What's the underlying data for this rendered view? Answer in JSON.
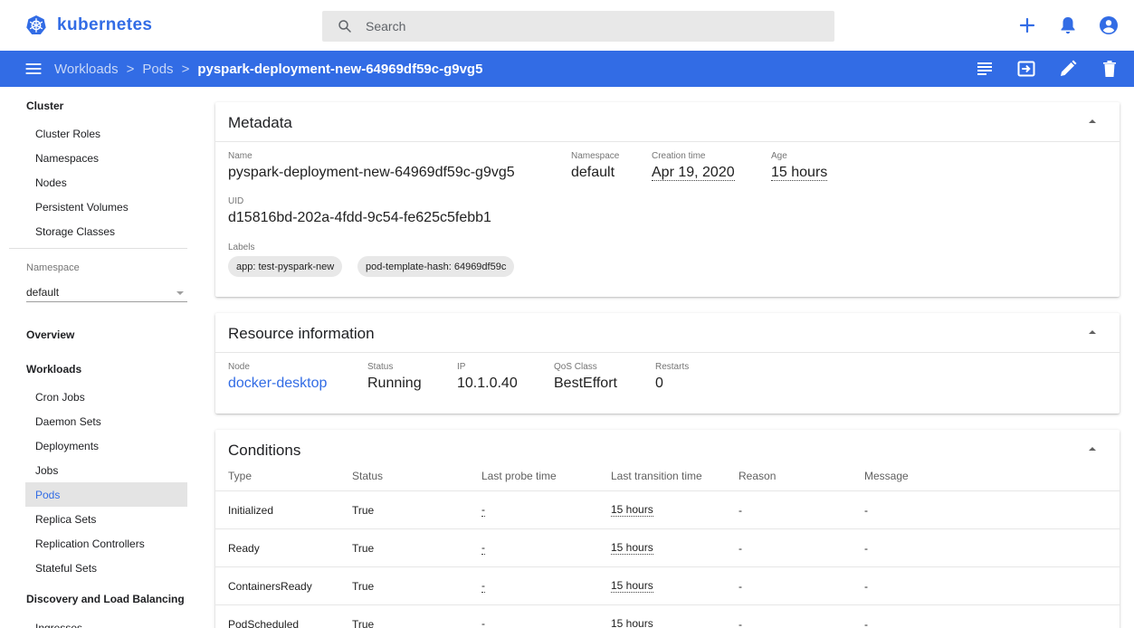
{
  "header": {
    "brand": "kubernetes",
    "search_placeholder": "Search"
  },
  "toolbar": {
    "breadcrumb": [
      "Workloads",
      "Pods"
    ],
    "separator": ">",
    "current": "pyspark-deployment-new-64969df59c-g9vg5"
  },
  "sidebar": {
    "cluster_header": "Cluster",
    "cluster_items": [
      "Cluster Roles",
      "Namespaces",
      "Nodes",
      "Persistent Volumes",
      "Storage Classes"
    ],
    "namespace_label": "Namespace",
    "namespace_value": "default",
    "overview": "Overview",
    "workloads_header": "Workloads",
    "workload_items": [
      "Cron Jobs",
      "Daemon Sets",
      "Deployments",
      "Jobs",
      "Pods",
      "Replica Sets",
      "Replication Controllers",
      "Stateful Sets"
    ],
    "active_item": "Pods",
    "discovery_header": "Discovery and Load Balancing",
    "discovery_items": [
      "Ingresses"
    ]
  },
  "metadata": {
    "title": "Metadata",
    "name_label": "Name",
    "name": "pyspark-deployment-new-64969df59c-g9vg5",
    "namespace_label": "Namespace",
    "namespace": "default",
    "creation_label": "Creation time",
    "creation": "Apr 19, 2020",
    "age_label": "Age",
    "age": "15 hours",
    "uid_label": "UID",
    "uid": "d15816bd-202a-4fdd-9c54-fe625c5febb1",
    "labels_label": "Labels",
    "labels": [
      "app: test-pyspark-new",
      "pod-template-hash: 64969df59c"
    ]
  },
  "resource": {
    "title": "Resource information",
    "node_label": "Node",
    "node": "docker-desktop",
    "status_label": "Status",
    "status": "Running",
    "ip_label": "IP",
    "ip": "10.1.0.40",
    "qos_label": "QoS Class",
    "qos": "BestEffort",
    "restarts_label": "Restarts",
    "restarts": "0"
  },
  "conditions": {
    "title": "Conditions",
    "columns": [
      "Type",
      "Status",
      "Last probe time",
      "Last transition time",
      "Reason",
      "Message"
    ],
    "rows": [
      [
        "Initialized",
        "True",
        "-",
        "15 hours",
        "-",
        "-"
      ],
      [
        "Ready",
        "True",
        "-",
        "15 hours",
        "-",
        "-"
      ],
      [
        "ContainersReady",
        "True",
        "-",
        "15 hours",
        "-",
        "-"
      ],
      [
        "PodScheduled",
        "True",
        "-",
        "15 hours",
        "-",
        "-"
      ]
    ]
  },
  "colors": {
    "primary": "#326ce5",
    "sidebar_active_bg": "#e4e4e4",
    "chip_bg": "#e8e8e8"
  },
  "icons": {
    "brand": "kubernetes-helm-icon",
    "search": "search-icon",
    "create": "plus-icon",
    "notifications": "bell-icon",
    "account": "account-circle-icon",
    "menu": "menu-icon",
    "logs": "logs-icon",
    "exec": "exec-shell-icon",
    "edit": "pencil-icon",
    "delete": "trash-icon",
    "collapse": "chevron-up-icon"
  }
}
